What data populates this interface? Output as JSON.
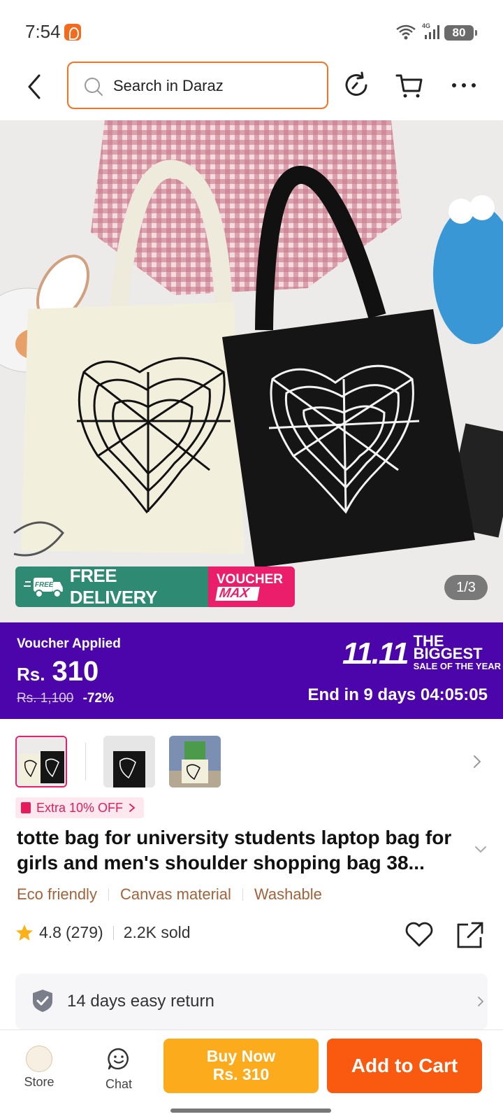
{
  "status_bar": {
    "time": "7:54",
    "network": "4G",
    "battery": "80"
  },
  "header": {
    "search_placeholder": "Search in Daraz"
  },
  "hero": {
    "delivery_label": "FREE DELIVERY",
    "delivery_badge": "FREE",
    "voucher_line1": "VOUCHER",
    "voucher_line2": "MAX",
    "image_counter": "1/3"
  },
  "price_banner": {
    "voucher_applied": "Voucher Applied",
    "currency": "Rs.",
    "price": "310",
    "original_price": "Rs. 1,100",
    "discount": "-72%",
    "sale_number": "11.11",
    "sale_line1": "THE BIGGEST",
    "sale_line2": "SALE OF THE YEAR",
    "timer": "End in 9 days 04:05:05"
  },
  "promo": {
    "extra_off": "Extra 10% OFF"
  },
  "product": {
    "title": "totte bag for university students laptop bag for girls and men's shoulder shopping bag 38...",
    "tags": [
      "Eco friendly",
      "Canvas material",
      "Washable"
    ],
    "rating": "4.8",
    "review_count": "(279)",
    "sold": "2.2K sold"
  },
  "service": {
    "return_policy": "14 days easy return"
  },
  "bottom_bar": {
    "store_label": "Store",
    "chat_label": "Chat",
    "buy_now_line1": "Buy Now",
    "buy_now_line2": "Rs. 310",
    "add_to_cart": "Add to Cart"
  },
  "colors": {
    "accent": "#f57224",
    "voucher_banner": "#4b05aa",
    "buy_now": "#fcab1d",
    "add_to_cart": "#fa5a0f",
    "delivery": "#2f8a74",
    "voucher_pink": "#ea1e6b"
  }
}
